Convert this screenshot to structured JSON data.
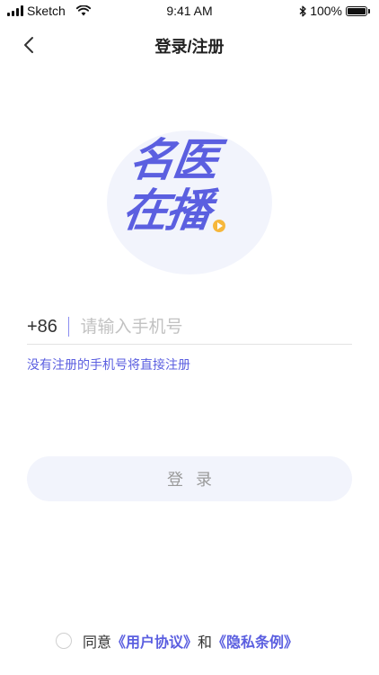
{
  "status_bar": {
    "carrier": "Sketch",
    "time": "9:41 AM",
    "battery": "100%",
    "battery_level": 1.0
  },
  "nav": {
    "title": "登录/注册"
  },
  "logo": {
    "line1": "名医",
    "line2": "在播"
  },
  "phone": {
    "country_code": "+86",
    "placeholder": "请输入手机号",
    "value": ""
  },
  "hint": "没有注册的手机号将直接注册",
  "login_button": "登录",
  "agreement": {
    "prefix": "同意",
    "user_agreement": "《用户协议》",
    "connector": "和",
    "privacy_policy": "《隐私条例》",
    "checked": false
  },
  "colors": {
    "accent": "#5b5fe0",
    "light_bg": "#f2f4fc",
    "badge": "#f6b73c"
  }
}
